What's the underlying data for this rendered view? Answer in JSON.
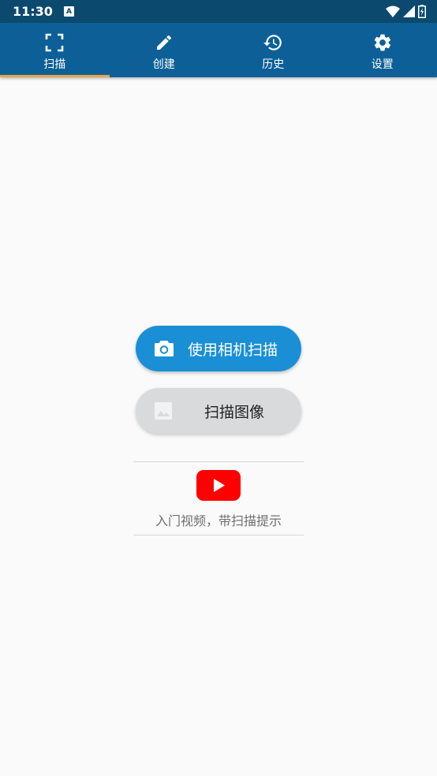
{
  "status_bar": {
    "time": "11:30",
    "badge": "A"
  },
  "tabs": [
    {
      "label": "扫描",
      "icon": "scan-frame-icon",
      "selected": true
    },
    {
      "label": "创建",
      "icon": "pencil-icon",
      "selected": false
    },
    {
      "label": "历史",
      "icon": "history-icon",
      "selected": false
    },
    {
      "label": "设置",
      "icon": "gear-icon",
      "selected": false
    }
  ],
  "actions": {
    "camera_label": "使用相机扫描",
    "image_label": "扫描图像"
  },
  "tutorial": {
    "text": "入门视频，带扫描提示",
    "icon": "youtube-play-icon"
  },
  "colors": {
    "status_bar": "#0b4a6e",
    "tab_bar": "#0d6097",
    "tab_indicator": "#e8a54a",
    "primary_button": "#1a8fd6",
    "secondary_button": "#d9dadb",
    "youtube_red": "#ff0000"
  }
}
